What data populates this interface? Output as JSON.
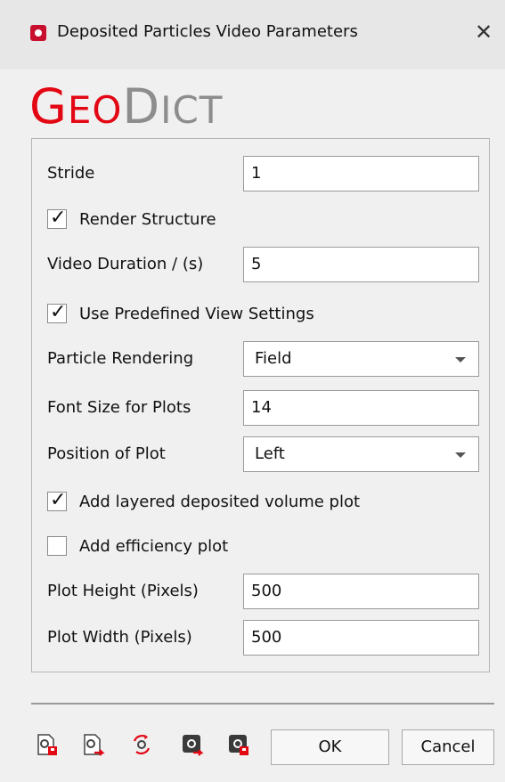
{
  "window": {
    "title": "Deposited Particles Video Parameters",
    "close_glyph": "✕"
  },
  "logo": {
    "geo_first": "G",
    "geo_rest": "EO",
    "dict_first": "D",
    "dict_rest": "ICT",
    "colors": {
      "geo": "#e30613",
      "dict": "#8d8d8d"
    }
  },
  "form": {
    "stride": {
      "label": "Stride",
      "value": "1"
    },
    "render_structure": {
      "label": "Render Structure",
      "checked": true
    },
    "video_duration": {
      "label": "Video Duration / (s)",
      "value": "5"
    },
    "use_predefined_view": {
      "label": "Use Predefined View Settings",
      "checked": true
    },
    "particle_rendering": {
      "label": "Particle Rendering",
      "selected": "Field"
    },
    "font_size_plots": {
      "label": "Font Size for Plots",
      "value": "14"
    },
    "position_of_plot": {
      "label": "Position of Plot",
      "selected": "Left"
    },
    "add_layered_volume_plot": {
      "label": "Add layered deposited volume plot",
      "checked": true
    },
    "add_efficiency_plot": {
      "label": "Add efficiency plot",
      "checked": false
    },
    "plot_height": {
      "label": "Plot Height (Pixels)",
      "value": "500"
    },
    "plot_width": {
      "label": "Plot Width (Pixels)",
      "value": "500"
    }
  },
  "footer": {
    "icons": [
      "save-settings-icon",
      "export-settings-icon",
      "reset-settings-icon",
      "load-settings-icon",
      "store-settings-icon"
    ],
    "ok_label": "OK",
    "cancel_label": "Cancel"
  }
}
